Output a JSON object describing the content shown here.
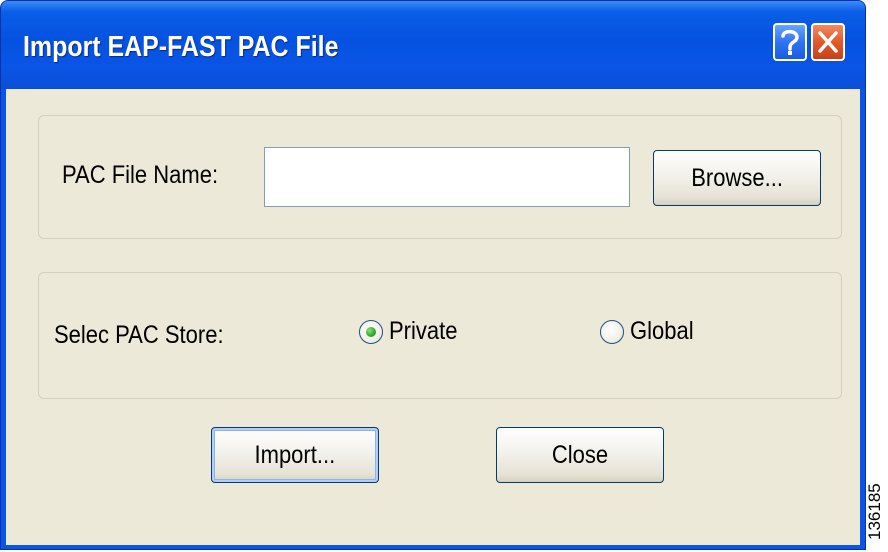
{
  "window": {
    "title": "Import EAP-FAST PAC File",
    "help_button_glyph": "?",
    "close_button_icon": "close-x-icon"
  },
  "file_group": {
    "label": "PAC File Name:",
    "file_name_value": "",
    "browse_label": "Browse..."
  },
  "store_group": {
    "label": "Selec PAC Store:",
    "options": [
      {
        "label": "Private",
        "selected": true
      },
      {
        "label": "Global",
        "selected": false
      }
    ]
  },
  "actions": {
    "import_label": "Import...",
    "close_label": "Close"
  },
  "figure_number": "136185",
  "colors": {
    "titlebar": "#0a55e6",
    "client_bg": "#ece9d8",
    "radio_selected": "#2fa82a",
    "close_button": "#e05a2a"
  }
}
